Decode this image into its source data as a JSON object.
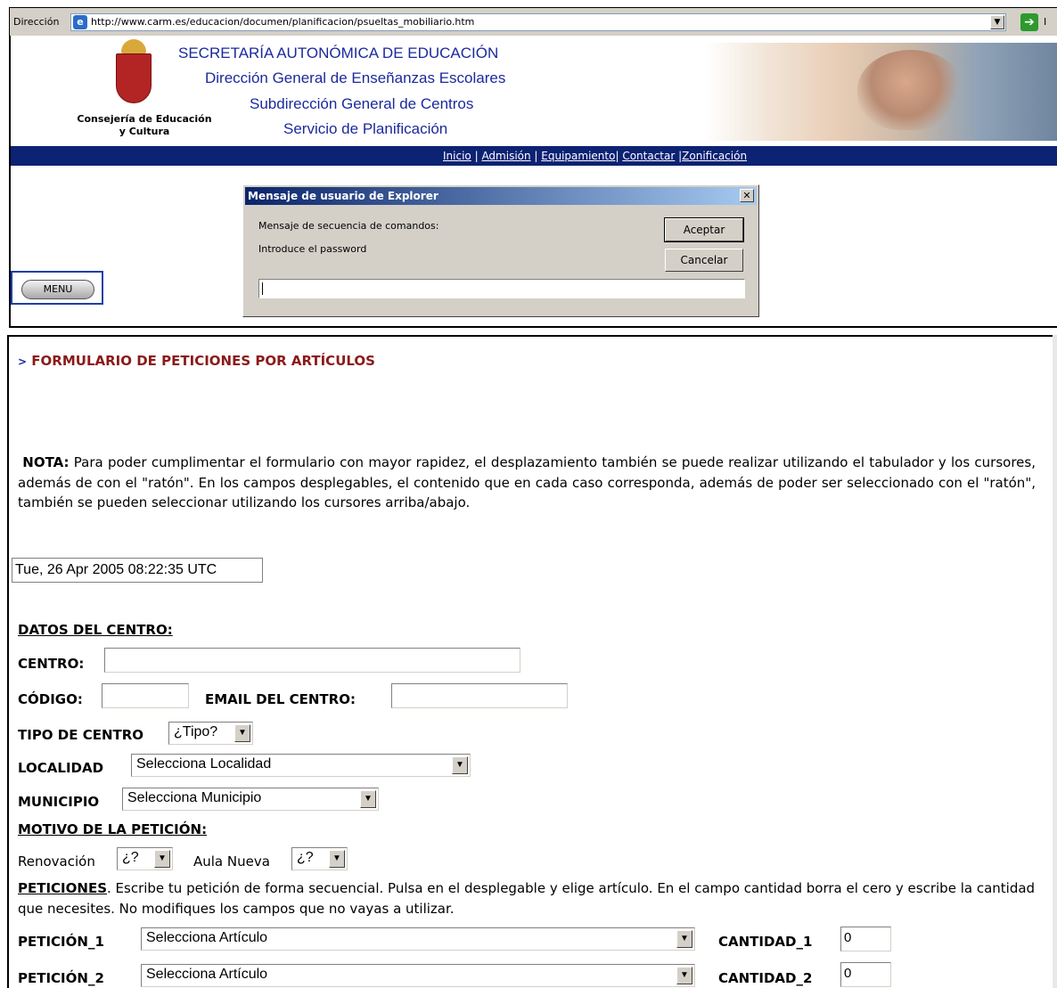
{
  "address_bar": {
    "label": "Dirección",
    "url": "http://www.carm.es/educacion/documen/planificacion/psueltas_mobiliario.htm",
    "go_tail": "I"
  },
  "header": {
    "consejeria": "Consejería de Educación y Cultura",
    "line1": "SECRETARÍA  AUTONÓMICA  DE  EDUCACIÓN",
    "line2": "Dirección General de Enseñanzas Escolares",
    "line3": "Subdirección General  de Centros",
    "line4": "Servicio de Planificación"
  },
  "nav": {
    "items": [
      "Inicio",
      "Admisión",
      "Equipamiento",
      "Contactar",
      "Zonificación"
    ]
  },
  "menu_button": "MENU",
  "dialog": {
    "title": "Mensaje de usuario de Explorer",
    "close": "✕",
    "message_label": "Mensaje de secuencia de comandos:",
    "message": "Introduce el password",
    "ok": "Aceptar",
    "cancel": "Cancelar",
    "input_value": ""
  },
  "form": {
    "title": "FORMULARIO DE PETICIONES POR ARTÍCULOS",
    "nota_label": "NOTA:",
    "nota_text": " Para poder cumplimentar el formulario con mayor rapidez, el desplazamiento también se puede realizar utilizando el tabulador y los cursores, además de con el \"ratón\". En los campos desplegables, el contenido que en cada caso corresponda, además de poder ser seleccionado con el \"ratón\", también se pueden seleccionar utilizando los cursores arriba/abajo.",
    "date": "Tue, 26 Apr 2005 08:22:35 UTC",
    "datos_centro": "DATOS DEL CENTRO:",
    "centro_label": "CENTRO:",
    "centro_value": "",
    "codigo_label": "CÓDIGO:",
    "codigo_value": "",
    "email_label": "EMAIL DEL CENTRO:",
    "email_value": "",
    "tipo_label": "TIPO DE CENTRO",
    "tipo_selected": "¿Tipo?",
    "localidad_label": "LOCALIDAD",
    "localidad_selected": "Selecciona Localidad",
    "municipio_label": "MUNICIPIO",
    "municipio_selected": "Selecciona Municipio",
    "motivo_label": "MOTIVO DE LA PETICIÓN:",
    "renovacion_label": "Renovación",
    "renovacion_selected": "¿?",
    "aula_label": "Aula Nueva",
    "aula_selected": "¿?",
    "peticiones_label": "PETICIONES",
    "peticiones_text": ". Escribe tu petición de forma secuencial. Pulsa en el desplegable y elige artículo. En el campo cantidad borra el cero y escribe la cantidad que necesites. No modifiques los campos que no vayas a utilizar.",
    "peticion_rows": [
      {
        "label": "PETICIÓN_1",
        "selected": "Selecciona Artículo",
        "qty_label": "CANTIDAD_1",
        "qty": "0"
      },
      {
        "label": "PETICIÓN_2",
        "selected": "Selecciona Artículo",
        "qty_label": "CANTIDAD_2",
        "qty": "0"
      }
    ]
  },
  "colors": {
    "nav_bar": "#0c2273",
    "header_text": "#1b2a9c",
    "form_title": "#8b1a1a",
    "dialog_title_start": "#0a246a",
    "dialog_title_end": "#a6caf0"
  },
  "icons": [
    "ie-page-icon",
    "go-arrow-icon",
    "dropdown-arrow-icon",
    "close-icon",
    "crest-icon"
  ]
}
